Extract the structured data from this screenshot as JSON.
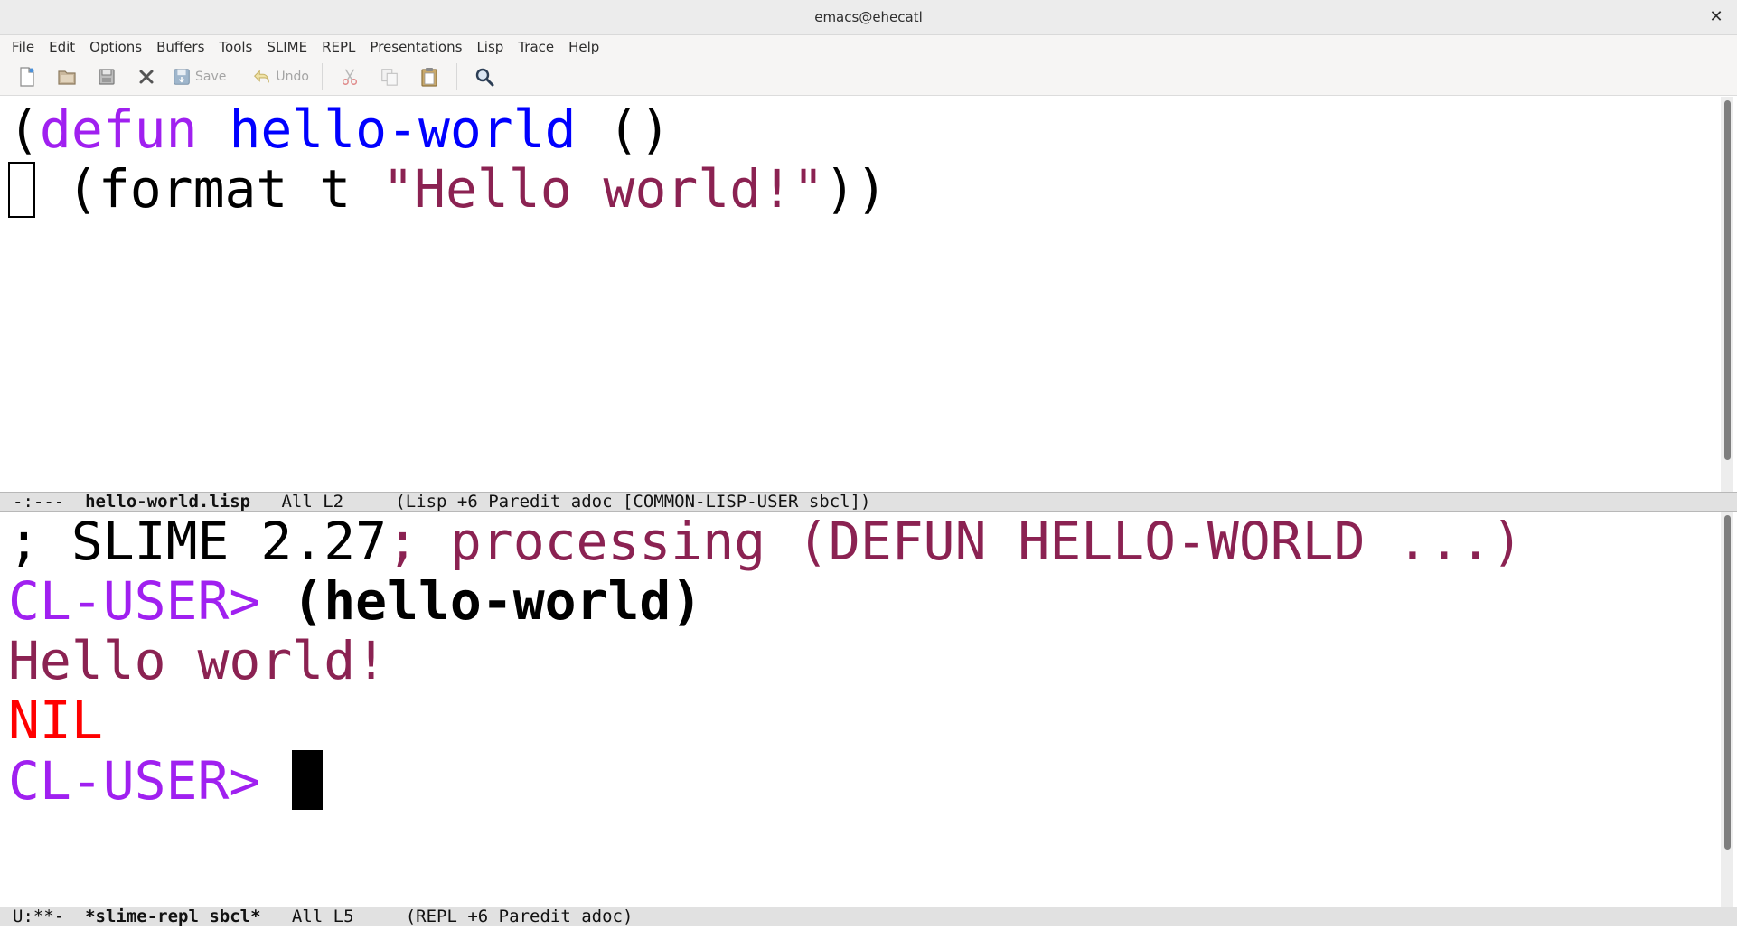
{
  "window": {
    "title": "emacs@ehecatl",
    "close_glyph": "✕"
  },
  "menu": {
    "items": [
      "File",
      "Edit",
      "Options",
      "Buffers",
      "Tools",
      "SLIME",
      "REPL",
      "Presentations",
      "Lisp",
      "Trace",
      "Help"
    ]
  },
  "toolbar": {
    "buttons": [
      {
        "icon": "new-file-icon"
      },
      {
        "icon": "open-folder-icon"
      },
      {
        "icon": "open-directory-icon"
      },
      {
        "icon": "close-buffer-icon"
      },
      {
        "icon": "save-icon",
        "label": "Save"
      },
      {
        "icon": "undo-icon",
        "label": "Undo"
      },
      {
        "icon": "cut-icon"
      },
      {
        "icon": "copy-icon"
      },
      {
        "icon": "paste-icon"
      },
      {
        "icon": "search-icon"
      }
    ]
  },
  "code_buffer": {
    "line1": {
      "open": "(",
      "keyword": "defun",
      "space1": " ",
      "name": "hello-world",
      "rest": " ()"
    },
    "line2": {
      "pre": " (format t ",
      "string": "\"Hello world!\"",
      "close": "))"
    }
  },
  "modeline_code": {
    "status": "-:---",
    "buffer": "hello-world.lisp",
    "position": "All L2",
    "modes": "(Lisp +6 Paredit adoc [COMMON-LISP-USER sbcl])"
  },
  "repl_buffer": {
    "banner": "; SLIME 2.27",
    "processing": "; processing (DEFUN HELLO-WORLD ...)",
    "prompt1": "CL-USER>",
    "input": "(hello-world)",
    "output": "Hello world!",
    "result": "NIL",
    "prompt2": "CL-USER>"
  },
  "modeline_repl": {
    "status": "U:**-",
    "buffer": "*slime-repl sbcl*",
    "position": "All L5",
    "modes": "(REPL +6 Paredit adoc)"
  },
  "colors": {
    "keyword": "#a020f0",
    "function_name": "#0000ff",
    "string": "#8b2252",
    "nil": "#ff0000"
  }
}
